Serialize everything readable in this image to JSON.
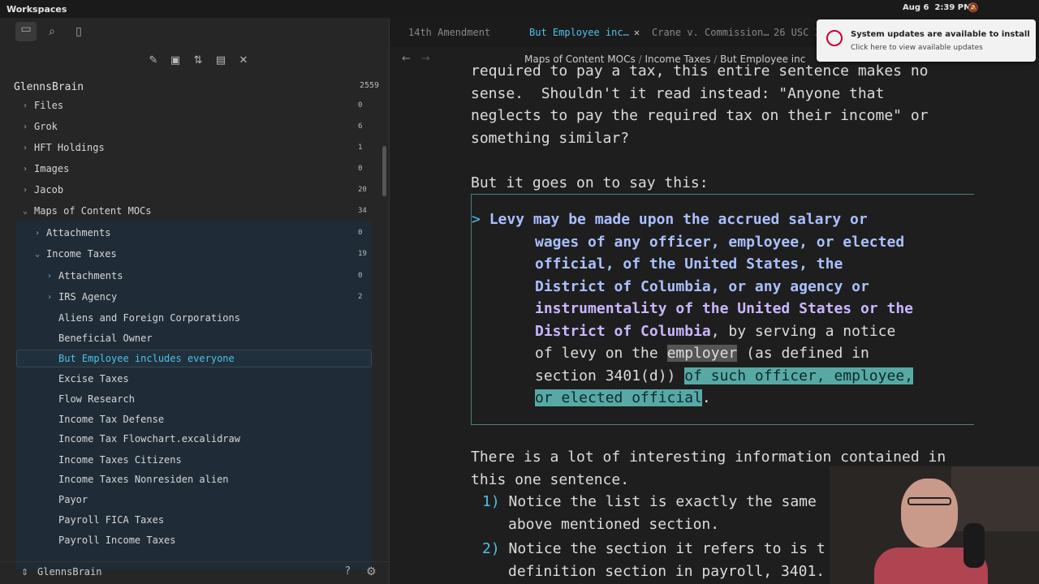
{
  "system_bar": {
    "workspaces": "Workspaces",
    "date": "Aug 6",
    "time": "2:39 PM"
  },
  "sidebar": {
    "vault_name": "GlennsBrain",
    "vault_count": "2559",
    "tree": [
      {
        "label": "Files",
        "count": "0",
        "type": "folder",
        "expanded": false,
        "depth": 0
      },
      {
        "label": "Grok",
        "count": "6",
        "type": "folder",
        "expanded": false,
        "depth": 0
      },
      {
        "label": "HFT Holdings",
        "count": "1",
        "type": "folder",
        "expanded": false,
        "depth": 0
      },
      {
        "label": "Images",
        "count": "0",
        "type": "folder",
        "expanded": false,
        "depth": 0
      },
      {
        "label": "Jacob",
        "count": "20",
        "type": "folder",
        "expanded": false,
        "depth": 0
      },
      {
        "label": "Maps of Content MOCs",
        "count": "34",
        "type": "folder",
        "expanded": true,
        "depth": 0
      },
      {
        "label": "Attachments",
        "count": "0",
        "type": "folder",
        "expanded": false,
        "depth": 1
      },
      {
        "label": "Income Taxes",
        "count": "19",
        "type": "folder",
        "expanded": true,
        "depth": 1
      },
      {
        "label": "Attachments",
        "count": "0",
        "type": "folder",
        "expanded": false,
        "depth": 2
      },
      {
        "label": "IRS Agency",
        "count": "2",
        "type": "folder",
        "expanded": false,
        "depth": 2
      },
      {
        "label": "Aliens and Foreign Corporations",
        "type": "file",
        "depth": 2
      },
      {
        "label": "Beneficial Owner",
        "type": "file",
        "depth": 2
      },
      {
        "label": "But Employee includes everyone",
        "type": "file",
        "depth": 2,
        "active": true
      },
      {
        "label": "Excise Taxes",
        "type": "file",
        "depth": 2
      },
      {
        "label": "Flow Research",
        "type": "file",
        "depth": 2
      },
      {
        "label": "Income Tax Defense",
        "type": "file",
        "depth": 2
      },
      {
        "label": "Income Tax Flowchart.excalidraw",
        "type": "file",
        "depth": 2
      },
      {
        "label": "Income Taxes Citizens",
        "type": "file",
        "depth": 2
      },
      {
        "label": "Income Taxes Nonresiden alien",
        "type": "file",
        "depth": 2
      },
      {
        "label": "Payor",
        "type": "file",
        "depth": 2
      },
      {
        "label": "Payroll FICA Taxes",
        "type": "file",
        "depth": 2
      },
      {
        "label": "Payroll Income Taxes",
        "type": "file",
        "depth": 2
      }
    ],
    "footer_vault": "GlennsBrain"
  },
  "tabs": [
    {
      "label": "14th Amendment"
    },
    {
      "label": "But Employee inc…",
      "active": true
    },
    {
      "label": "Crane v. Commission…"
    },
    {
      "label": "26 USC 3"
    }
  ],
  "breadcrumbs": [
    "Maps of Content MOCs",
    "Income Taxes",
    "But Employee inc"
  ],
  "document": {
    "line0": "required to pay a tax, this entire sentence makes no",
    "line1": "sense.  Shouldn't it read instead: \"Anyone that",
    "line2": "neglects to pay the required tax on their income\" or",
    "line3": "something similar?",
    "line4": "But it goes on to say this:",
    "quote": {
      "l1": "Levy may be made upon the accrued salary or",
      "l2": "wages of any officer, employee, or elected",
      "l3": "official, of the United States, the",
      "l4": "District of Columbia, or any agency or",
      "l5": "instrumentality of the United States or the",
      "l6a": "District of Columbia",
      "l6b": ", by serving a notice",
      "l7a": "of levy on the ",
      "l7b": "employer",
      "l7c": " (as defined in",
      "l8a": "section 3401(d)) ",
      "l8b": "of such officer, employee,",
      "l9a": "or elected official",
      "l9b": "."
    },
    "p2a": "There is a lot of interesting information contained in",
    "p2b": "this one sentence.",
    "item1_num": "1)",
    "item1a": "Notice the list is exactly the same",
    "item1b": "above mentioned section.",
    "item2_num": "2)",
    "item2a": "Notice the section it refers to is t",
    "item2b": "definition section in payroll, 3401."
  },
  "notification": {
    "title": "System updates are available to install",
    "subtitle": "Click here to view available updates"
  }
}
